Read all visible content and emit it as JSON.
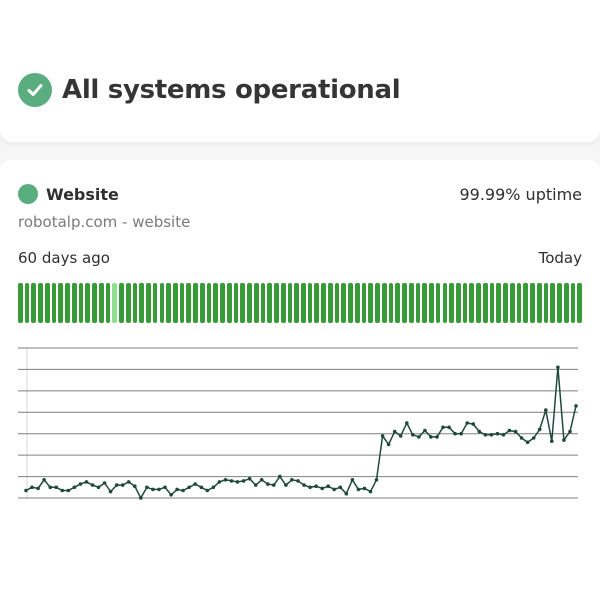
{
  "status": {
    "title": "All systems operational",
    "icon": "check-circle-icon",
    "color": "#5aad7e"
  },
  "monitor": {
    "name": "Website",
    "dot_color": "#5aad7e",
    "uptime": "99.99% uptime",
    "url": "robotalp.com - website",
    "range_start": "60 days ago",
    "range_end": "Today",
    "bar_color": "#379b37",
    "bar_partial_color": "#8ee08e",
    "days": [
      "up",
      "up",
      "up",
      "up",
      "up",
      "up",
      "up",
      "up",
      "up",
      "up",
      "up",
      "up",
      "up",
      "up",
      "partial",
      "up",
      "up",
      "up",
      "up",
      "up",
      "up",
      "up",
      "up",
      "up",
      "up",
      "up",
      "up",
      "up",
      "up",
      "up",
      "up",
      "up",
      "up",
      "up",
      "up",
      "up",
      "up",
      "up",
      "up",
      "up",
      "up",
      "up",
      "up",
      "up",
      "up",
      "up",
      "up",
      "up",
      "up",
      "up",
      "up",
      "up",
      "up",
      "up",
      "up",
      "up",
      "up",
      "up",
      "up",
      "up",
      "up",
      "up",
      "up",
      "up",
      "up",
      "up",
      "up",
      "up",
      "up",
      "up",
      "up",
      "up",
      "up",
      "up",
      "up",
      "up",
      "up",
      "up",
      "up",
      "up",
      "up",
      "up",
      "up",
      "up"
    ]
  },
  "chart_data": {
    "type": "line",
    "title": "",
    "xlabel": "",
    "ylabel": "",
    "grid": true,
    "ylim": [
      0,
      7
    ],
    "line_color": "#1f4a3a",
    "series": [
      {
        "values": [
          0.35,
          0.5,
          0.45,
          0.85,
          0.5,
          0.5,
          0.35,
          0.35,
          0.5,
          0.65,
          0.75,
          0.6,
          0.5,
          0.7,
          0.3,
          0.6,
          0.6,
          0.75,
          0.55,
          0.0,
          0.5,
          0.4,
          0.4,
          0.5,
          0.15,
          0.4,
          0.35,
          0.5,
          0.65,
          0.5,
          0.35,
          0.5,
          0.75,
          0.85,
          0.8,
          0.75,
          0.8,
          0.9,
          0.6,
          0.85,
          0.65,
          0.6,
          1.0,
          0.6,
          0.85,
          0.8,
          0.6,
          0.5,
          0.55,
          0.45,
          0.55,
          0.4,
          0.5,
          0.2,
          0.85,
          0.4,
          0.45,
          0.3,
          0.85,
          2.9,
          2.5,
          3.1,
          2.9,
          3.5,
          2.95,
          2.85,
          3.15,
          2.85,
          2.85,
          3.3,
          3.3,
          3.0,
          3.0,
          3.5,
          3.45,
          3.1,
          2.95,
          2.95,
          3.0,
          2.95,
          3.15,
          3.1,
          2.8,
          2.6,
          2.8,
          3.2,
          4.1,
          2.65,
          6.1,
          2.7,
          3.1,
          4.3
        ]
      }
    ]
  }
}
